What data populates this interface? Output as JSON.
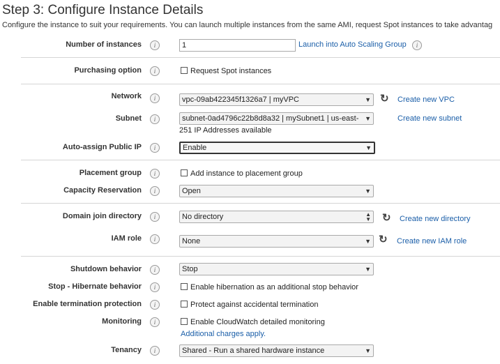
{
  "page": {
    "title": "Step 3: Configure Instance Details",
    "subtitle": "Configure the instance to suit your requirements. You can launch multiple instances from the same AMI, request Spot instances to take advantag"
  },
  "rows": {
    "num_instances": {
      "label": "Number of instances",
      "value": "1",
      "link": "Launch into Auto Scaling Group"
    },
    "purchasing": {
      "label": "Purchasing option",
      "checkbox": "Request Spot instances"
    },
    "network": {
      "label": "Network",
      "value": "vpc-09ab422345f1326a7 | myVPC",
      "link": "Create new VPC"
    },
    "subnet": {
      "label": "Subnet",
      "value": "subnet-0ad4796c22b8d8a32 | mySubnet1 | us-east-",
      "note": "251 IP Addresses available",
      "link": "Create new subnet"
    },
    "public_ip": {
      "label": "Auto-assign Public IP",
      "value": "Enable"
    },
    "placement": {
      "label": "Placement group",
      "checkbox": "Add instance to placement group"
    },
    "capacity": {
      "label": "Capacity Reservation",
      "value": "Open"
    },
    "domain": {
      "label": "Domain join directory",
      "value": "No directory",
      "link": "Create new directory"
    },
    "iam": {
      "label": "IAM role",
      "value": "None",
      "link": "Create new IAM role"
    },
    "shutdown": {
      "label": "Shutdown behavior",
      "value": "Stop"
    },
    "hibernate": {
      "label": "Stop - Hibernate behavior",
      "checkbox": "Enable hibernation as an additional stop behavior"
    },
    "termination": {
      "label": "Enable termination protection",
      "checkbox": "Protect against accidental termination"
    },
    "monitoring": {
      "label": "Monitoring",
      "checkbox": "Enable CloudWatch detailed monitoring",
      "link": "Additional charges apply."
    },
    "tenancy": {
      "label": "Tenancy",
      "value": "Shared - Run a shared hardware instance"
    }
  },
  "icons": {
    "info": "info-icon",
    "refresh": "refresh-icon",
    "dropdown": "chevron-down-icon"
  },
  "colors": {
    "link": "#1a5ea8",
    "divider": "#d5d5d5",
    "text": "#333333"
  }
}
